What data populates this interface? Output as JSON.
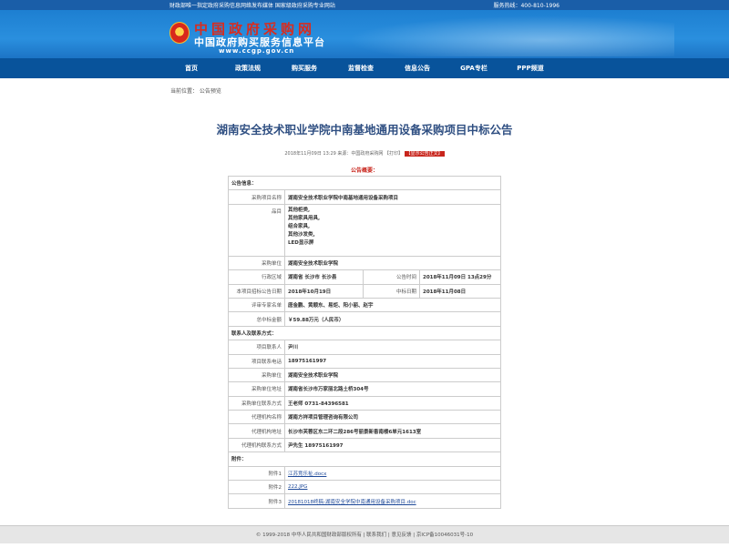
{
  "topbar": {
    "left": "财政部唯一指定政府采购信息网络发布媒体  国家级政府采购专业网站",
    "right": "服务热线：400-810-1996"
  },
  "logo": {
    "line1": "中国政府采购网",
    "line2": "中国政府购买服务信息平台",
    "url": "www.ccgp.gov.cn"
  },
  "nav": [
    "首页",
    "政策法规",
    "购买服务",
    "监督检查",
    "信息公告",
    "GPA专栏",
    "PPP频道"
  ],
  "breadcrumb": "当前位置：  公告预览",
  "notice": {
    "title": "湖南安全技术职业学院中南基地通用设备采购项目中标公告",
    "meta": "2018年11月09日 13:29  来源：中国政府采购网  【打印】",
    "meta_badge": "【显示公告正文】",
    "summary_label": "公告概要："
  },
  "table": {
    "section_info": "公告信息：",
    "project_name_label": "采购项目名称",
    "project_name": "湖南安全技术职业学院中南基地通用设备采购项目",
    "items_label": "品目",
    "items": [
      "其他柜类,",
      "其他家具用具,",
      "组合家具,",
      "其他沙发类,",
      "LED显示屏"
    ],
    "purchaser_label": "采购单位",
    "purchaser": "湖南安全技术职业学院",
    "region_label": "行政区域",
    "region": "湖南省  长沙市  长沙县",
    "announce_time_label": "公告时间",
    "announce_time": "2018年11月09日  13点29分",
    "bid_date_label": "本项目招标公告日期",
    "bid_date": "2018年10月19日",
    "award_date_label": "中标日期",
    "award_date": "2018年11月08日",
    "experts_label": "评审专家名单",
    "experts": "唐金鹏、黄顺东、易炬、阳小丽、赵宇",
    "total_label": "总中标金额",
    "total": "￥59.88万元（人民币）",
    "section_contact": "联系人及联系方式：",
    "contact_label": "项目联系人",
    "contact": "尹川",
    "phone_label": "项目联系电话",
    "phone": "18975161997",
    "unit_label": "采购单位",
    "unit": "湖南安全技术职业学院",
    "unit_addr_label": "采购单位地址",
    "unit_addr": "湖南省长沙市万家丽北路土桥304号",
    "unit_contact_label": "采购单位联系方式",
    "unit_contact": "王老师  0731-84396581",
    "agency_label": "代理机构名称",
    "agency": "湖南方祥项目管理咨询有限公司",
    "agency_addr_label": "代理机构地址",
    "agency_addr": "长沙市芙蓉区东二环二段286号丽景新香南楼6单元1613室",
    "agency_contact_label": "代理机构联系方式",
    "agency_contact": "尹先生  18975161997",
    "section_attach": "附件：",
    "att1_label": "附件1",
    "att1": "江苏竞乐祉.docx",
    "att2_label": "附件2",
    "att2": "222.JPG",
    "att3_label": "附件3",
    "att3": "20181018终稿-湖南安全学院中南通用设备采购项目.doc"
  },
  "footer": "© 1999-2018  中华人民共和国财政部版权所有  |  联系我们  |  意见反馈  |  京ICP备10046031号-10"
}
